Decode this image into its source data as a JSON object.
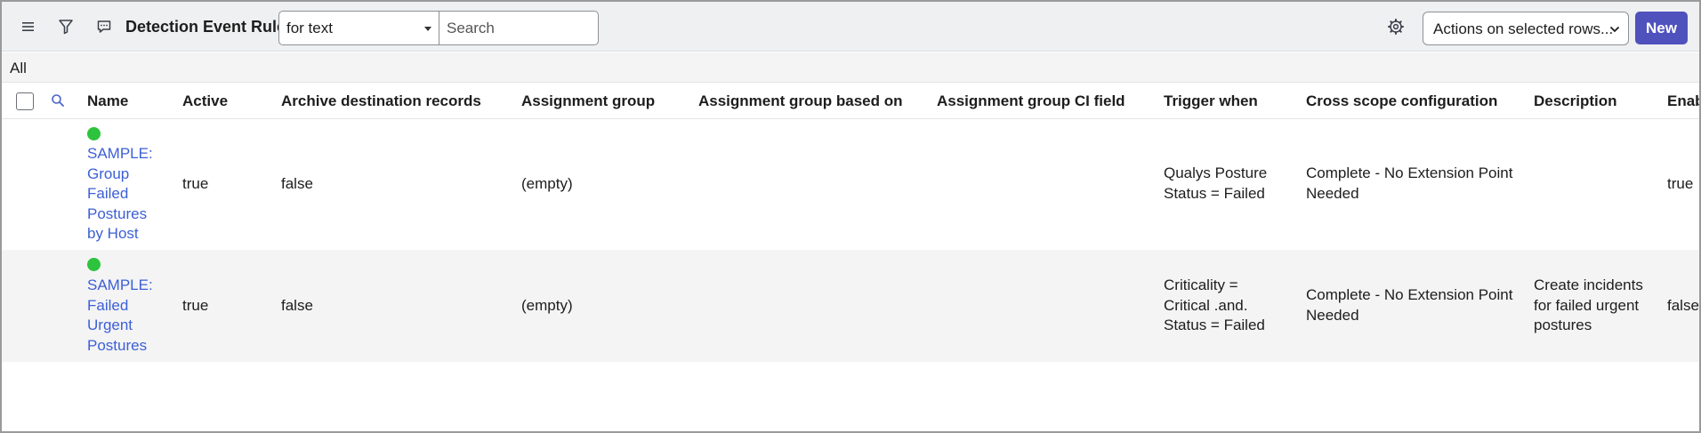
{
  "header": {
    "title": "Detection Event Rules",
    "filter_select_value": "for text",
    "search_placeholder": "Search",
    "actions_select_value": "Actions on selected rows...",
    "new_button_label": "New",
    "icons": [
      "hamburger-menu-icon",
      "filter-icon",
      "chat-bubble-icon",
      "gear-icon"
    ]
  },
  "breadcrumb": {
    "label": "All"
  },
  "table": {
    "columns": [
      "Name",
      "Active",
      "Archive destination records",
      "Assignment group",
      "Assignment group based on",
      "Assignment group CI field",
      "Trigger when",
      "Cross scope configuration",
      "Description",
      "Enab"
    ],
    "rows": [
      {
        "status_color": "#2dc33c",
        "name_lines": [
          "SAMPLE:",
          "Group",
          "Failed",
          "Postures",
          "by Host"
        ],
        "active": "true",
        "archive_destination_records": "false",
        "assignment_group": "(empty)",
        "assignment_group_based_on": "",
        "assignment_group_ci_field": "",
        "trigger_when_lines": [
          "Qualys Posture",
          "Status = Failed"
        ],
        "cross_scope_lines": [
          "Complete - No Extension Point",
          "Needed"
        ],
        "description_lines": [],
        "enabled": "true"
      },
      {
        "status_color": "#2dc33c",
        "name_lines": [
          "SAMPLE:",
          "Failed",
          "Urgent",
          "Postures"
        ],
        "active": "true",
        "archive_destination_records": "false",
        "assignment_group": "(empty)",
        "assignment_group_based_on": "",
        "assignment_group_ci_field": "",
        "trigger_when_lines": [
          "Criticality =",
          "Critical .and.",
          "Status = Failed"
        ],
        "cross_scope_lines": [
          "Complete - No Extension Point",
          "Needed"
        ],
        "description_lines": [
          "Create incidents",
          "for failed urgent",
          "postures"
        ],
        "enabled": "false"
      }
    ]
  },
  "colors": {
    "accent": "#4f52bd",
    "link": "#3c5fd6",
    "active_dot": "#2dc33c",
    "header_bg": "#eef0f1"
  }
}
